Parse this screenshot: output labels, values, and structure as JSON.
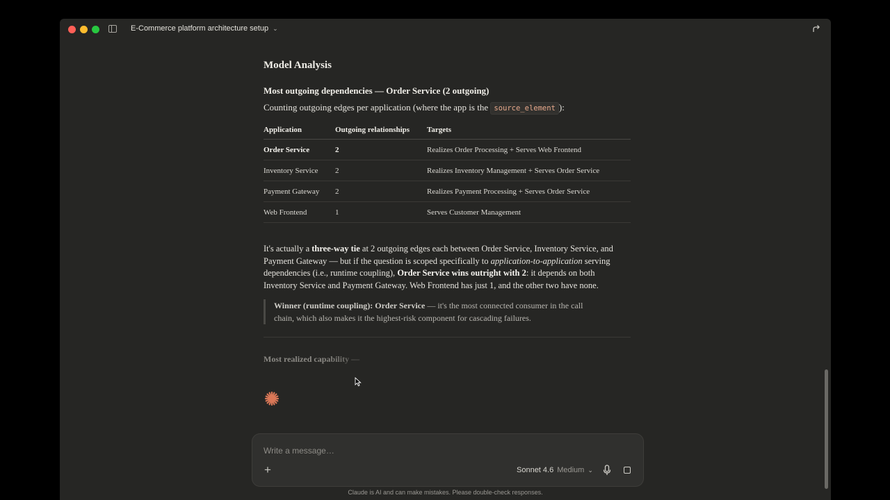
{
  "window": {
    "title": "E-Commerce platform architecture setup"
  },
  "message": {
    "heading": "Model Analysis",
    "subheading": "Most outgoing dependencies — Order Service (2 outgoing)",
    "intro_prefix": "Counting outgoing edges per application (where the app is the ",
    "intro_code": "source_element",
    "intro_suffix": "):",
    "table": {
      "headers": [
        "Application",
        "Outgoing relationships",
        "Targets"
      ],
      "rows": [
        {
          "application": "Order Service",
          "count": "2",
          "targets": "Realizes Order Processing + Serves Web Frontend"
        },
        {
          "application": "Inventory Service",
          "count": "2",
          "targets": "Realizes Inventory Management + Serves Order Service"
        },
        {
          "application": "Payment Gateway",
          "count": "2",
          "targets": "Realizes Payment Processing + Serves Order Service"
        },
        {
          "application": "Web Frontend",
          "count": "1",
          "targets": "Serves Customer Management"
        }
      ]
    },
    "analysis": {
      "t1": "It's actually a ",
      "b1": "three-way tie",
      "t2": " at 2 outgoing edges each between Order Service, Inventory Service, and Payment Gateway — but if the question is scoped specifically to ",
      "i1": "application-to-application",
      "t3": " serving dependencies (i.e., runtime coupling), ",
      "b2": "Order Service wins outright with 2",
      "t4": ": it depends on both Inventory Service and Payment Gateway. Web Frontend has just 1, and the other two have none."
    },
    "quote": {
      "bold": "Winner (runtime coupling): Order Service",
      "text": " — it's the most connected consumer in the call chain, which also makes it the highest-risk component for cascading failures."
    },
    "streaming_text": "Most realized capability —"
  },
  "composer": {
    "placeholder": "Write a message…",
    "model": "Sonnet 4.6",
    "effort": "Medium"
  },
  "disclaimer": "Claude is AI and can make mistakes. Please double-check responses.",
  "colors": {
    "accent_spark": "#d97757",
    "background": "#262624"
  },
  "icons": [
    "sidebar-toggle-icon",
    "chevron-down-icon",
    "share-icon",
    "spark-icon",
    "plus-icon",
    "chevron-down-icon",
    "mic-icon",
    "stop-icon"
  ]
}
